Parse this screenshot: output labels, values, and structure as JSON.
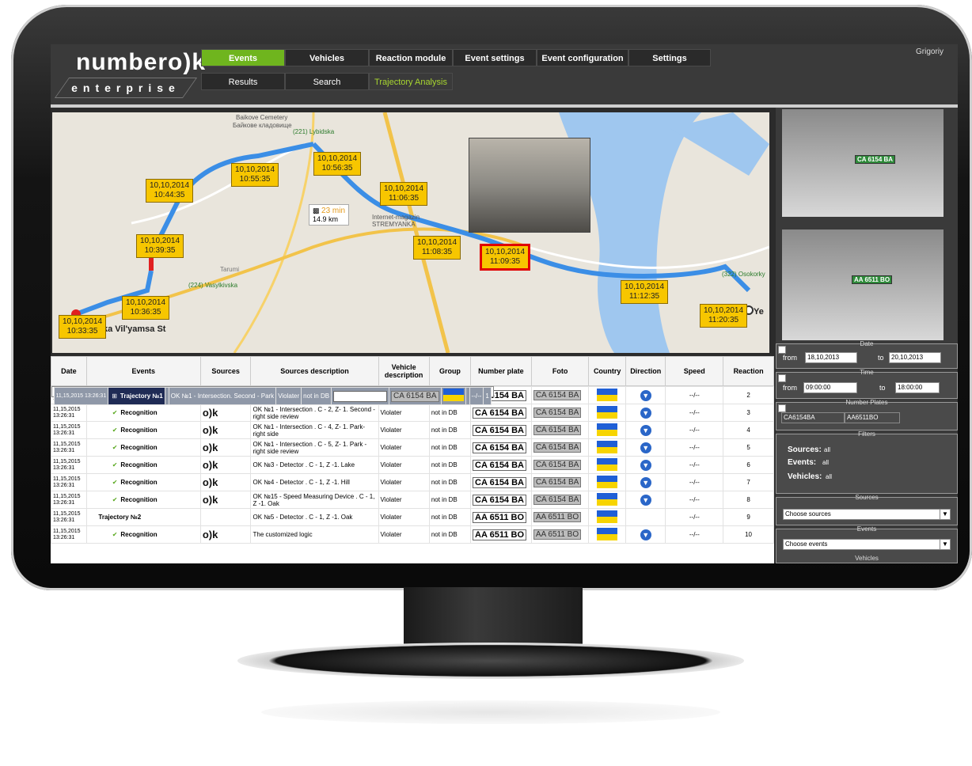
{
  "app": {
    "logo": "number",
    "logo_ok": "o)k",
    "logo_sub": "enterprise",
    "user": "Grigoriy"
  },
  "nav": {
    "tabs": [
      {
        "label": "Events"
      },
      {
        "label": "Vehicles"
      },
      {
        "label": "Reaction module"
      },
      {
        "label": "Event settings"
      },
      {
        "label": "Event configuration"
      },
      {
        "label": "Settings"
      }
    ],
    "subtabs": [
      {
        "label": "Results"
      },
      {
        "label": "Search"
      },
      {
        "label": "Trajectory Analysis"
      }
    ]
  },
  "map": {
    "route_time": "23 min",
    "route_distance": "14.9 km",
    "labels": [
      {
        "text": "Baikove Cemetery"
      },
      {
        "text": "Байкове кладовище"
      },
      {
        "text": "(221) Lybidska"
      },
      {
        "text": "Tarumi"
      },
      {
        "text": "(224) Vasylkivska"
      },
      {
        "text": "Internet-magazin STREMYANKA"
      },
      {
        "text": "(322) Osokorky"
      },
      {
        "text": "ka Vil'yamsa St"
      },
      {
        "text": "Ye"
      }
    ],
    "markers": [
      {
        "date": "10,10,2014",
        "time": "10:33:35"
      },
      {
        "date": "10,10,2014",
        "time": "10:36:35"
      },
      {
        "date": "10,10,2014",
        "time": "10:39:35"
      },
      {
        "date": "10,10,2014",
        "time": "10:44:35"
      },
      {
        "date": "10,10,2014",
        "time": "10:55:35"
      },
      {
        "date": "10,10,2014",
        "time": "10:56:35"
      },
      {
        "date": "10,10,2014",
        "time": "11:06:35"
      },
      {
        "date": "10,10,2014",
        "time": "11:08:35"
      },
      {
        "date": "10,10,2014",
        "time": "11:09:35"
      },
      {
        "date": "10,10,2014",
        "time": "11:12:35"
      },
      {
        "date": "10,10,2014",
        "time": "11:20:35"
      }
    ]
  },
  "table": {
    "headers": [
      "Date",
      "Events",
      "Sources",
      "Sources description",
      "Vehicle description",
      "Group",
      "Number plate",
      "Foto",
      "Country",
      "Direction",
      "Speed",
      "Reaction"
    ],
    "rows": [
      {
        "date": "11,15,2015 13:26:31",
        "event": "Trajectory №1",
        "source": "",
        "desc": "OK №1 - Intersection. Second - Park",
        "vehicle": "Violater",
        "group": "not in DB",
        "plate": "CA 6154 BA",
        "foto": "CA 6154 BA",
        "speed": "--/--",
        "reaction": "1",
        "kind": "trajectory"
      },
      {
        "date": "11,15,2015 13:26:31",
        "event": "Recognition",
        "source": "o)k",
        "desc": "OK №1 - Intersection . C - 1, Z- 1. Second - right side",
        "vehicle": "Violater",
        "group": "not in DB",
        "plate": "CA 6154 BA",
        "foto": "CA 6154 BA",
        "speed": "--/--",
        "reaction": "2",
        "kind": "recognition"
      },
      {
        "date": "11,15,2015 13:26:31",
        "event": "Recognition",
        "source": "o)k",
        "desc": "OK №1 - Intersection . C - 2, Z- 1. Second - right side review",
        "vehicle": "Violater",
        "group": "not in DB",
        "plate": "CA 6154 BA",
        "foto": "CA 6154 BA",
        "speed": "--/--",
        "reaction": "3",
        "kind": "recognition"
      },
      {
        "date": "11,15,2015 13:26:31",
        "event": "Recognition",
        "source": "o)k",
        "desc": "OK №1 - Intersection . C - 4, Z- 1. Park- right side",
        "vehicle": "Violater",
        "group": "not in DB",
        "plate": "CA 6154 BA",
        "foto": "CA 6154 BA",
        "speed": "--/--",
        "reaction": "4",
        "kind": "recognition"
      },
      {
        "date": "11,15,2015 13:26:31",
        "event": "Recognition",
        "source": "o)k",
        "desc": "OK №1 - Intersection . C - 5, Z- 1. Park - right side review",
        "vehicle": "Violater",
        "group": "not in DB",
        "plate": "CA 6154 BA",
        "foto": "CA 6154 BA",
        "speed": "--/--",
        "reaction": "5",
        "kind": "recognition"
      },
      {
        "date": "11,15,2015 13:26:31",
        "event": "Recognition",
        "source": "o)k",
        "desc": "OK №3 - Detector . C - 1, Z -1. Lake",
        "vehicle": "Violater",
        "group": "not in DB",
        "plate": "CA 6154 BA",
        "foto": "CA 6154 BA",
        "speed": "--/--",
        "reaction": "6",
        "kind": "recognition"
      },
      {
        "date": "11,15,2015 13:26:31",
        "event": "Recognition",
        "source": "o)k",
        "desc": "OK №4 - Detector . C - 1, Z -1. Hill",
        "vehicle": "Violater",
        "group": "not in DB",
        "plate": "CA 6154 BA",
        "foto": "CA 6154 BA",
        "speed": "--/--",
        "reaction": "7",
        "kind": "recognition"
      },
      {
        "date": "11,15,2015 13:26:31",
        "event": "Recognition",
        "source": "o)k",
        "desc": "OK №15 - Speed Measuring Device . C - 1, Z -1. Oak",
        "vehicle": "Violater",
        "group": "not in DB",
        "plate": "CA 6154 BA",
        "foto": "CA 6154 BA",
        "speed": "--/--",
        "reaction": "8",
        "kind": "recognition"
      },
      {
        "date": "11,15,2015 13:26:31",
        "event": "Trajectory №2",
        "source": "",
        "desc": "OK №5 - Detector . C - 1, Z -1. Oak",
        "vehicle": "Violater",
        "group": "not in DB",
        "plate": "AA 6511 BO",
        "foto": "AA 6511 BO",
        "speed": "--/--",
        "reaction": "9",
        "kind": "trajectory"
      },
      {
        "date": "11,15,2015 13:26:31",
        "event": "Recognition",
        "source": "o)k",
        "desc": "The customized logic",
        "vehicle": "Violater",
        "group": "not in DB",
        "plate": "AA 6511 BO",
        "foto": "AA 6511 BO",
        "speed": "--/--",
        "reaction": "10",
        "kind": "recognition"
      }
    ]
  },
  "sidebar": {
    "cam1_plate": "CA 6154 BA",
    "cam2_plate": "AA 6511 BO",
    "date": {
      "label": "Date",
      "from_label": "from",
      "from": "18,10,2013",
      "to_label": "to",
      "to": "20,10,2013"
    },
    "time": {
      "label": "Time",
      "from_label": "from",
      "from": "09:00:00",
      "to_label": "to",
      "to": "18:00:00"
    },
    "plates": {
      "label": "Number Plates",
      "p1": "CA6154BA",
      "p2": "AA6511BO"
    },
    "filters": {
      "label": "Filters",
      "sources": "Sources:",
      "sources_val": "all",
      "events": "Events:",
      "events_val": "all",
      "vehicles": "Vehicles:",
      "vehicles_val": "all"
    },
    "sources": {
      "label": "Sources",
      "placeholder": "Choose sources"
    },
    "events": {
      "label": "Events",
      "placeholder": "Choose events"
    },
    "vehicles": {
      "label": "Vehicles"
    }
  }
}
